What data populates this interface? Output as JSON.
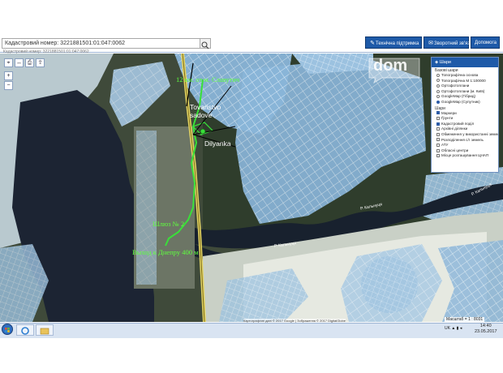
{
  "toolbar": {
    "search_value": "Кадастровий номер: 3221881501:01:047:0062",
    "search_hint": "Кадастровий номер: 3221881501:01:047:0062",
    "buttons": [
      {
        "label": "Технічна підтримка",
        "icon": "wrench-icon"
      },
      {
        "label": "Зворотний зв'язок",
        "icon": "envelope-icon"
      },
      {
        "label": "Допомога",
        "icon": "help-icon"
      }
    ]
  },
  "map_tools": {
    "row1": [
      "select-icon",
      "measure-icon",
      "print-icon",
      "share-icon"
    ],
    "zoom_in": "+",
    "zoom_out": "−"
  },
  "overlay_labels": {
    "distance_top": "12 км. от м. Славутич",
    "plot_name_line1": "Tovaristvo",
    "plot_name_line2": "sadove",
    "plot_title": "Dilyanka",
    "lock": "Шлюз № 2",
    "exit": "Выход к Днепру 400 м"
  },
  "river_labels": [
    "Р. Кальнуця",
    "Р. Кальнуця",
    "Р. Кальнуця"
  ],
  "layers_panel": {
    "title": "Шари",
    "base_section": "Базові шари",
    "base_layers": [
      {
        "label": "Топографічна основа",
        "checked": false
      },
      {
        "label": "Топографічна М 1:100000",
        "checked": false
      },
      {
        "label": "Ортофотоплани",
        "checked": false
      },
      {
        "label": "Ортофотоплани (м. Київ)",
        "checked": false
      },
      {
        "label": "GoogleMap (Гібрид)",
        "checked": false
      },
      {
        "label": "GoogleMap (Супутник)",
        "checked": true
      }
    ],
    "overlay_section": "Шари",
    "overlay_layers": [
      {
        "label": "Маркери",
        "checked": true
      },
      {
        "label": "Ґрунти",
        "checked": false
      },
      {
        "label": "Кадастровий поділ",
        "checked": true
      },
      {
        "label": "Архівні ділянки",
        "checked": false
      },
      {
        "label": "Обмеження у використанні земель",
        "checked": false
      },
      {
        "label": "Розподілення с/г земель",
        "checked": false
      },
      {
        "label": "АТУ",
        "checked": false
      },
      {
        "label": "Обласні центри",
        "checked": false
      },
      {
        "label": "Місце розташування ЦНАП",
        "checked": false
      }
    ]
  },
  "watermark": "dom",
  "scale": "Масштаб = 1 : 8031",
  "credits": "Картографічні дані © 2017 Google | Зображення © 2017 DigitalGlobe",
  "taskbar": {
    "language": "UK",
    "time": "14:40",
    "date": "23.05.2017"
  },
  "colors": {
    "accent": "#1e5aa8",
    "overlay_green": "#39e039",
    "parcel_fill": "#8fb8dc",
    "road": "#e3d463"
  }
}
